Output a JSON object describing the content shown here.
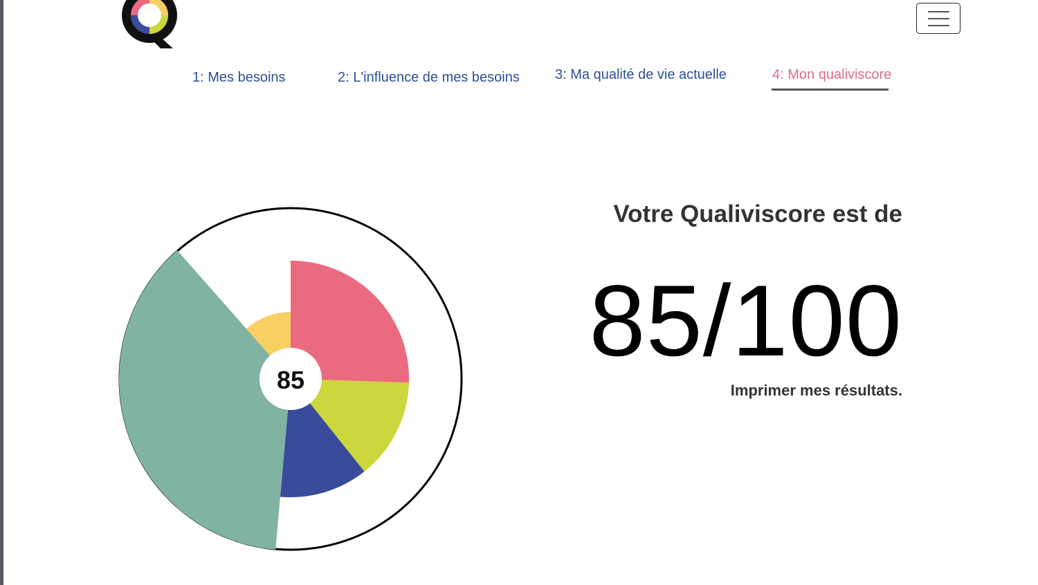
{
  "nav": {
    "items": [
      {
        "label": "1: Mes besoins"
      },
      {
        "label": "2: L'influence de mes besoins"
      },
      {
        "label": "3: Ma qualité de vie actuelle"
      },
      {
        "label": "4: Mon qualiviscore"
      }
    ]
  },
  "result": {
    "heading": "Votre Qualiviscore est de",
    "score": "85/100",
    "print_label": "Imprimer mes résultats."
  },
  "chart_data": {
    "type": "pie",
    "center_label": "85",
    "values": [
      {
        "fraction": 0.255,
        "radius_fraction": 0.69,
        "color": "#ea6b80"
      },
      {
        "fraction": 0.138,
        "radius_fraction": 0.69,
        "color": "#cbd73c"
      },
      {
        "fraction": 0.121,
        "radius_fraction": 0.69,
        "color": "#394b9a"
      },
      {
        "fraction": 0.371,
        "radius_fraction": 1.0,
        "color": "#80b3a1"
      },
      {
        "fraction": 0.115,
        "radius_fraction": 0.39,
        "color": "#f7cf63"
      }
    ]
  },
  "colors": {
    "nav_link": "#2f4f98",
    "nav_active": "#e06c84"
  },
  "icons": {
    "logo": "qualiviscore-logo-icon",
    "menu": "hamburger-menu-icon"
  }
}
